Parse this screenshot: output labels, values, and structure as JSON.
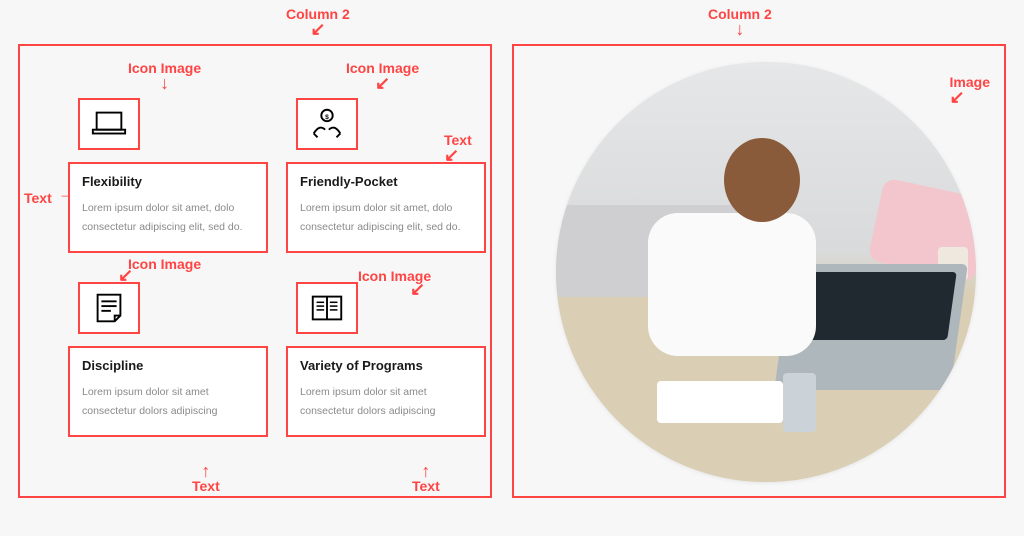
{
  "annotations": {
    "column2_top_left": "Column 2",
    "column2_top_right": "Column 2",
    "icon_image": "Icon Image",
    "text_label": "Text",
    "image_label": "Image"
  },
  "features": [
    {
      "title": "Flexibility",
      "body": "Lorem ipsum dolor sit amet, dolo consectetur adipiscing elit, sed do."
    },
    {
      "title": "Friendly-Pocket",
      "body": "Lorem ipsum dolor sit amet, dolo consectetur adipiscing elit, sed do."
    },
    {
      "title": "Discipline",
      "body": "Lorem ipsum dolor sit amet consectetur dolors adipiscing"
    },
    {
      "title": "Variety of Programs",
      "body": "Lorem ipsum dolor sit amet consectetur dolors adipiscing"
    }
  ],
  "colors": {
    "annotation": "#ff4444"
  }
}
